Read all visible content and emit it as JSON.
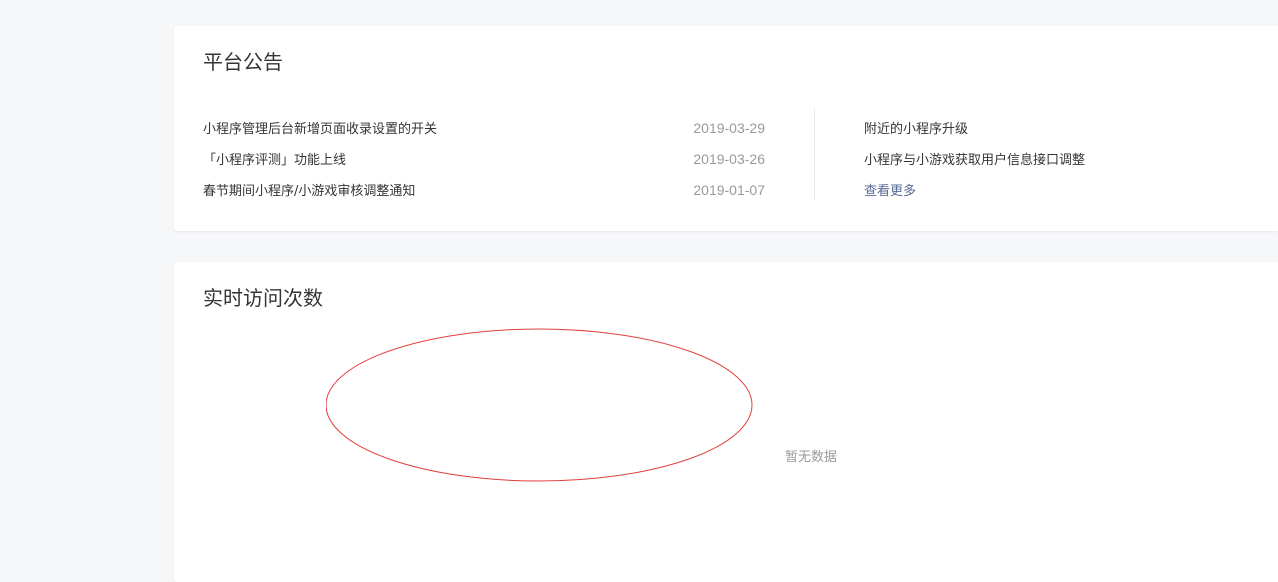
{
  "notice": {
    "title": "平台公告",
    "items": [
      {
        "title": "小程序管理后台新增页面收录设置的开关",
        "date": "2019-03-29"
      },
      {
        "title": "「小程序评测」功能上线",
        "date": "2019-03-26"
      },
      {
        "title": "春节期间小程序/小游戏审核调整通知",
        "date": "2019-01-07"
      }
    ],
    "side_links": [
      "附近的小程序升级",
      "小程序与小游戏获取用户信息接口调整"
    ],
    "more_label": "查看更多"
  },
  "visits": {
    "title": "实时访问次数",
    "empty_text": "暂无数据"
  },
  "colors": {
    "background": "#f6f7f9",
    "card": "#ffffff",
    "text": "#353535",
    "muted": "#9a9a9a",
    "link": "#576b95",
    "annotation": "#e0403c"
  }
}
